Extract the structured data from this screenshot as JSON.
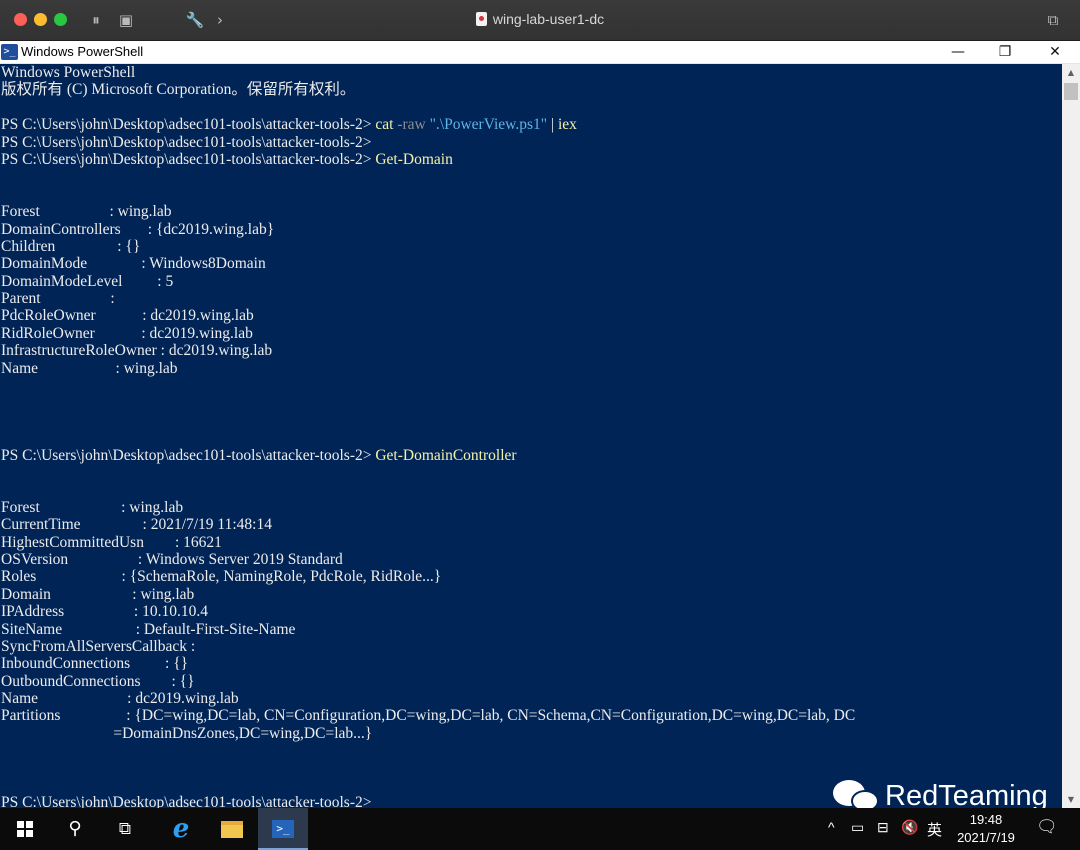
{
  "vm_window": {
    "title": "wing-lab-user1-dc",
    "icons": {
      "pause": "pause-icon",
      "sidebar": "sidebar-toggle-icon",
      "tools": "wrench-icon",
      "forward": "chevron-right-icon",
      "copy": "window-copy-icon"
    }
  },
  "ps_window": {
    "title": "Windows PowerShell",
    "controls": {
      "minimize": "—",
      "maximize": "❐",
      "close": "✕"
    }
  },
  "console": {
    "header": [
      "Windows PowerShell",
      "版权所有 (C) Microsoft Corporation。保留所有权利。"
    ],
    "prompt": "PS C:\\Users\\john\\Desktop\\adsec101-tools\\attacker-tools-2> ",
    "commands": {
      "cat_cmd": "cat",
      "cat_param": "-raw",
      "cat_str": "\".\\PowerView.ps1\"",
      "pipe": "|",
      "iex": "iex",
      "get_domain": "Get-Domain",
      "get_dc": "Get-DomainController"
    },
    "get_domain_output": [
      "Forest                  : wing.lab",
      "DomainControllers       : {dc2019.wing.lab}",
      "Children                : {}",
      "DomainMode              : Windows8Domain",
      "DomainModeLevel         : 5",
      "Parent                  :",
      "PdcRoleOwner            : dc2019.wing.lab",
      "RidRoleOwner            : dc2019.wing.lab",
      "InfrastructureRoleOwner : dc2019.wing.lab",
      "Name                    : wing.lab"
    ],
    "get_dc_output": [
      "Forest                     : wing.lab",
      "CurrentTime                : 2021/7/19 11:48:14",
      "HighestCommittedUsn        : 16621",
      "OSVersion                  : Windows Server 2019 Standard",
      "Roles                      : {SchemaRole, NamingRole, PdcRole, RidRole...}",
      "Domain                     : wing.lab",
      "IPAddress                  : 10.10.10.4",
      "SiteName                   : Default-First-Site-Name",
      "SyncFromAllServersCallback :",
      "InboundConnections         : {}",
      "OutboundConnections        : {}",
      "Name                       : dc2019.wing.lab",
      "Partitions                 : {DC=wing,DC=lab, CN=Configuration,DC=wing,DC=lab, CN=Schema,CN=Configuration,DC=wing,DC=lab, DC",
      "                             =DomainDnsZones,DC=wing,DC=lab...}"
    ]
  },
  "watermark": {
    "text": "RedTeaming",
    "icon": "wechat-icon"
  },
  "taskbar": {
    "icons": {
      "start": "windows-start-icon",
      "search": "search-icon",
      "taskview": "task-view-icon",
      "ie": "internet-explorer-icon",
      "explorer": "file-explorer-icon",
      "powershell": "powershell-icon"
    },
    "tray": {
      "chevron": "^",
      "ime": "英",
      "network": "network-icon",
      "volume": "volume-muted-icon",
      "display": "display-icon",
      "notification": "notification-icon"
    },
    "clock": {
      "time": "19:48",
      "date": "2021/7/19"
    }
  },
  "colors": {
    "console_bg": "#012456",
    "console_fg": "#ececec",
    "command": "#f5f2a8",
    "string": "#5fb4e6",
    "param": "#8e8e8e"
  }
}
